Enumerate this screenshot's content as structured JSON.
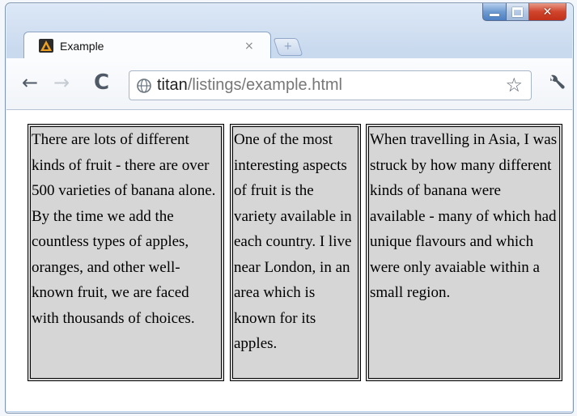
{
  "tab": {
    "title": "Example",
    "close_glyph": "×"
  },
  "newtab": {
    "glyph": "+"
  },
  "address_bar": {
    "host": "titan",
    "path": "/listings/example.html"
  },
  "toolbar": {
    "back_glyph": "←",
    "forward_glyph": "→",
    "reload_glyph": "C",
    "star_glyph": "☆"
  },
  "window": {
    "close_glyph": "✕"
  },
  "content": {
    "columns": [
      "There are lots of different kinds of fruit - there are over 500 varieties of banana alone. By the time we add the countless types of apples, oranges, and other well-known fruit, we are faced with thousands of choices.",
      "One of the most interesting aspects of fruit is the variety available in each country. I live near London, in an area which is known for its apples.",
      "When travelling in Asia, I was struck by how many different kinds of banana were available - many of which had unique flavours and which were only avaiable within a small region."
    ]
  },
  "colors": {
    "column_bg": "#d6d6d6",
    "column_border": "#000000",
    "window_frame": "#c9d9ee"
  }
}
